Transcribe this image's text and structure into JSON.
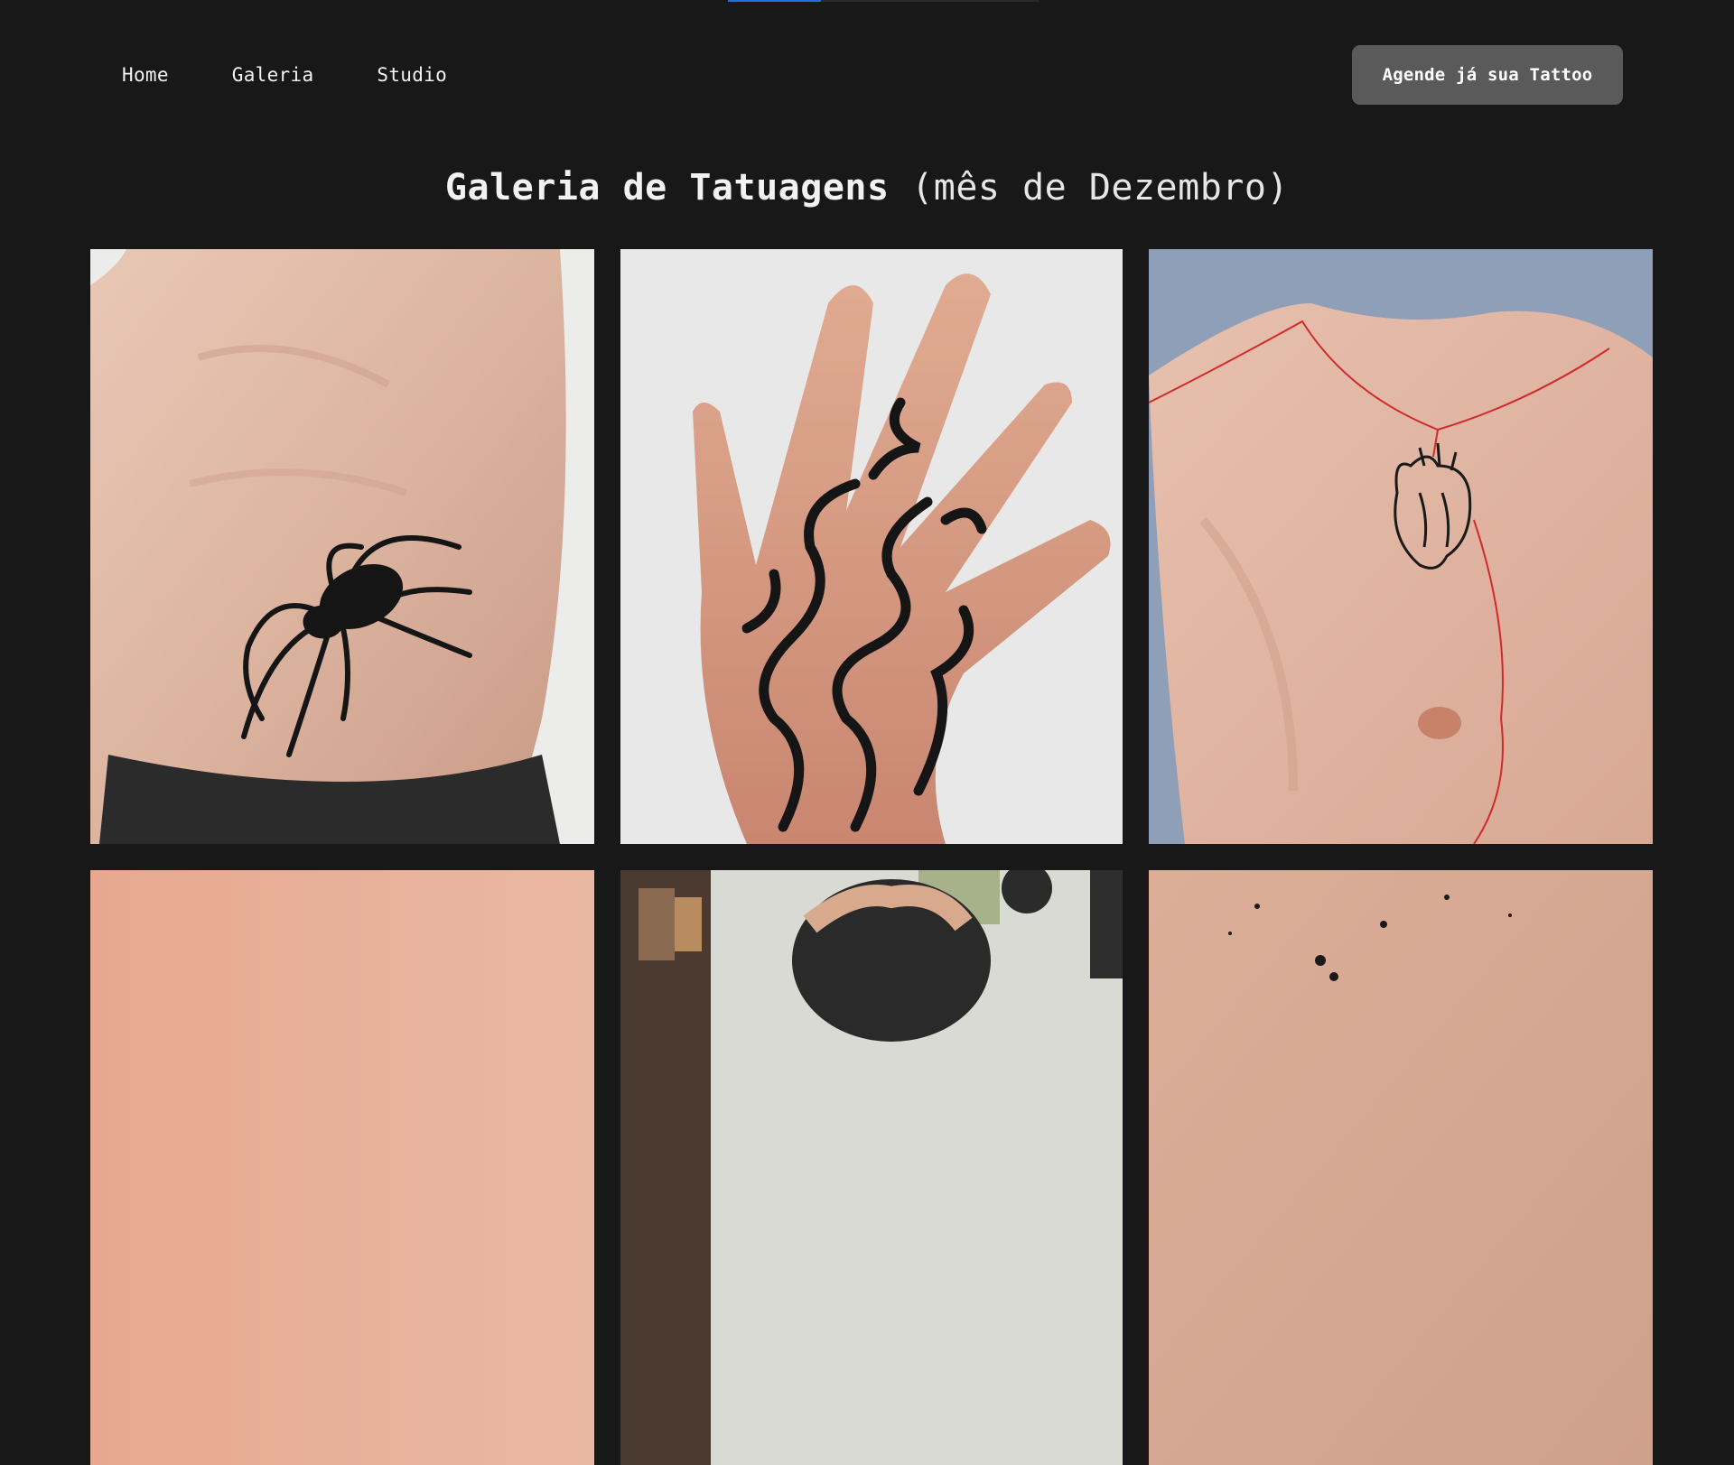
{
  "nav": {
    "links": [
      "Home",
      "Galeria",
      "Studio"
    ],
    "cta_label": "Agende já sua Tattoo"
  },
  "top_indicator": {
    "progress_fraction": 0.3,
    "color": "#1f6fe0"
  },
  "page_title": {
    "strong": "Galeria de Tatuagens",
    "light": "(mês de Dezembro)"
  },
  "gallery": {
    "tiles": [
      {
        "subject": "spider tattoo on ribs",
        "icon": "spider-icon"
      },
      {
        "subject": "tribal flame tattoo on hand",
        "icon": "hand-icon"
      },
      {
        "subject": "anatomical heart tattoo on chest",
        "icon": "heart-icon"
      },
      {
        "subject": "skin close-up",
        "icon": "skin-icon"
      },
      {
        "subject": "head tattoo in studio",
        "icon": "head-icon"
      },
      {
        "subject": "dotwork tattoo on skin",
        "icon": "dots-icon"
      }
    ]
  },
  "colors": {
    "background": "#181818",
    "button": "#5a5a5a",
    "text": "#f2f2f2",
    "tattoo_ink": "#111111",
    "red_line": "#d22a2a"
  }
}
